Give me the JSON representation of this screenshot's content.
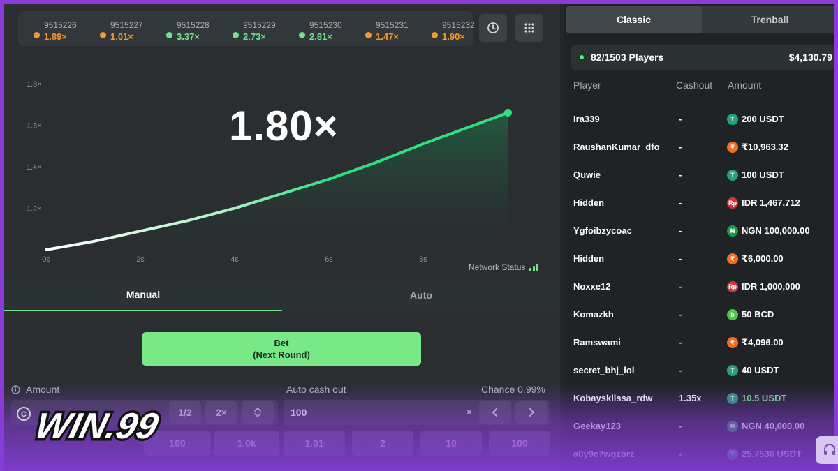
{
  "history": [
    {
      "id": "9515226",
      "value": "1.89×",
      "color": "#f39a2b"
    },
    {
      "id": "9515227",
      "value": "1.01×",
      "color": "#f39a2b"
    },
    {
      "id": "9515228",
      "value": "3.37×",
      "color": "#6fe588"
    },
    {
      "id": "9515229",
      "value": "2.73×",
      "color": "#6fe588"
    },
    {
      "id": "9515230",
      "value": "2.81×",
      "color": "#6fe588"
    },
    {
      "id": "9515231",
      "value": "1.47×",
      "color": "#f39a2b"
    },
    {
      "id": "9515232",
      "value": "1.90×",
      "color": "#f39a2b"
    }
  ],
  "history_buttons": {
    "clock": "clock-icon",
    "grid": "grid-icon"
  },
  "chart_data": {
    "type": "line",
    "x": [
      0,
      1,
      2,
      3,
      4,
      5,
      6,
      7,
      8,
      9.8
    ],
    "y": [
      1.0,
      1.04,
      1.09,
      1.14,
      1.2,
      1.27,
      1.34,
      1.42,
      1.51,
      1.66
    ],
    "xticks": [
      "0s",
      "2s",
      "4s",
      "6s",
      "8s"
    ],
    "yticks": [
      "1.2×",
      "1.4×",
      "1.6×",
      "1.8×"
    ],
    "xlim": [
      0,
      10
    ],
    "ylim": [
      1.0,
      1.9
    ],
    "line_color": "#2fe07f"
  },
  "multiplier": "1.80×",
  "network_status": "Network Status",
  "tabs": {
    "manual": "Manual",
    "auto": "Auto"
  },
  "bet_button": {
    "line1": "Bet",
    "line2": "(Next Round)"
  },
  "amount": {
    "label": "Amount",
    "half": "1/2",
    "double": "2×",
    "quick": [
      "100",
      "1.0k"
    ]
  },
  "auto_cashout": {
    "label": "Auto cash out",
    "value": "100",
    "suffix": "×",
    "chance_label": "Chance 0.99%",
    "quick": [
      "1.01",
      "2",
      "10",
      "100"
    ]
  },
  "panel": {
    "tabs": {
      "classic": "Classic",
      "trenball": "Trenball"
    },
    "players_count": "82/1503 Players",
    "total": "$4,130.79",
    "headers": {
      "player": "Player",
      "cashout": "Cashout",
      "amount": "Amount"
    },
    "rows": [
      {
        "name": "Ira339",
        "cashout": "-",
        "amount": "200 USDT",
        "coin": "T",
        "coin_color": "#26a17b",
        "amount_color": "#ffffff"
      },
      {
        "name": "RaushanKumar_dfo",
        "cashout": "-",
        "amount": "₹10,963.32",
        "coin": "₹",
        "coin_color": "#f26d21",
        "amount_color": "#ffffff"
      },
      {
        "name": "Quwie",
        "cashout": "-",
        "amount": "100 USDT",
        "coin": "T",
        "coin_color": "#26a17b",
        "amount_color": "#ffffff"
      },
      {
        "name": "Hidden",
        "cashout": "-",
        "amount": "IDR 1,467,712",
        "coin": "Rp",
        "coin_color": "#d8313a",
        "amount_color": "#ffffff"
      },
      {
        "name": "Ygfoibzycoac",
        "cashout": "-",
        "amount": "NGN 100,000.00",
        "coin": "₦",
        "coin_color": "#1f9a4b",
        "amount_color": "#ffffff"
      },
      {
        "name": "Hidden",
        "cashout": "-",
        "amount": "₹6,000.00",
        "coin": "₹",
        "coin_color": "#f26d21",
        "amount_color": "#ffffff"
      },
      {
        "name": "Noxxe12",
        "cashout": "-",
        "amount": "IDR 1,000,000",
        "coin": "Rp",
        "coin_color": "#d8313a",
        "amount_color": "#ffffff"
      },
      {
        "name": "Komazkh",
        "cashout": "-",
        "amount": "50 BCD",
        "coin": "b",
        "coin_color": "#4ac84a",
        "amount_color": "#ffffff"
      },
      {
        "name": "Ramswami",
        "cashout": "-",
        "amount": "₹4,096.00",
        "coin": "₹",
        "coin_color": "#f26d21",
        "amount_color": "#ffffff"
      },
      {
        "name": "secret_bhj_lol",
        "cashout": "-",
        "amount": "40 USDT",
        "coin": "T",
        "coin_color": "#26a17b",
        "amount_color": "#ffffff"
      },
      {
        "name": "Kobayskilssa_rdw",
        "cashout": "1.35x",
        "amount": "10.5 USDT",
        "coin": "T",
        "coin_color": "#26a17b",
        "amount_color": "#6fe588"
      },
      {
        "name": "Geekay123",
        "cashout": "-",
        "amount": "NGN 40,000.00",
        "coin": "₦",
        "coin_color": "#1f9a4b",
        "amount_color": "#ffffff"
      },
      {
        "name": "a0y9c7wgzbrz",
        "cashout": "-",
        "amount": "25.7536 USDT",
        "coin": "T",
        "coin_color": "#26a17b",
        "amount_color": "#ffffff"
      }
    ]
  },
  "logo": {
    "text": "WIN.99"
  }
}
